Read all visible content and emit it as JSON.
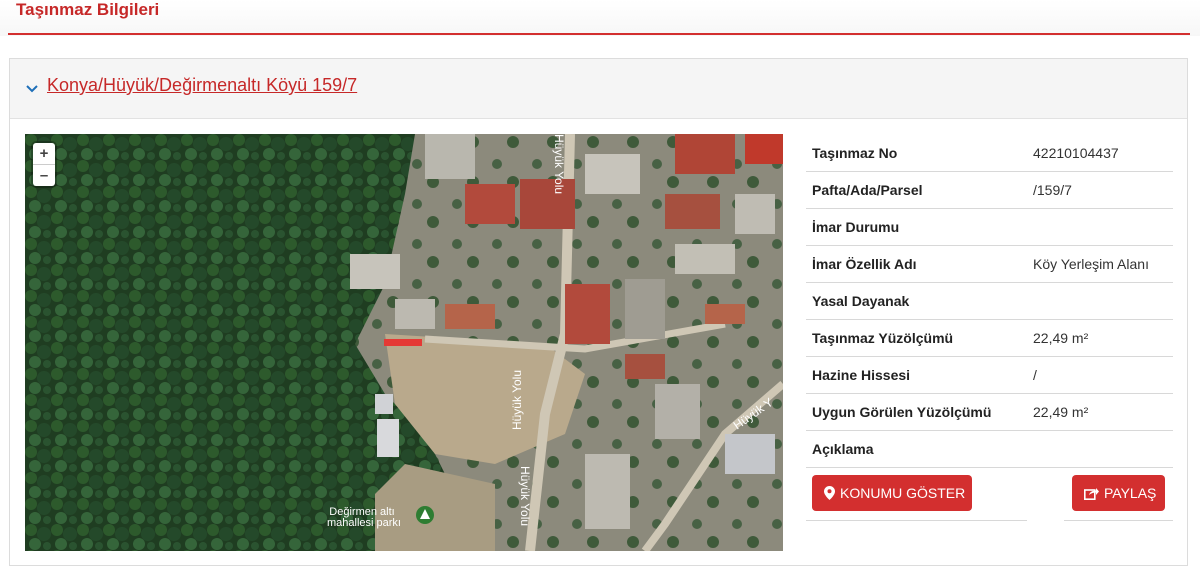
{
  "page": {
    "title": "Taşınmaz Bilgileri"
  },
  "panel": {
    "title": "Konya/Hüyük/Değirmenaltı Köyü 159/7"
  },
  "map": {
    "zoom_in": "+",
    "zoom_out": "–",
    "road_label_1": "Hüyük Yolu",
    "road_label_2": "Hüyük Yolu",
    "road_label_3": "Hüyük Yolu",
    "road_label_4": "Hüyük Y",
    "park_label_1": "Değirmen altı",
    "park_label_2": "mahallesi parkı"
  },
  "info": {
    "rows": [
      {
        "label": "Taşınmaz No",
        "value": "42210104437"
      },
      {
        "label": "Pafta/Ada/Parsel",
        "value": "/159/7"
      },
      {
        "label": "İmar Durumu",
        "value": ""
      },
      {
        "label": "İmar Özellik Adı",
        "value": "Köy Yerleşim Alanı"
      },
      {
        "label": "Yasal Dayanak",
        "value": ""
      },
      {
        "label": "Taşınmaz Yüzölçümü",
        "value": "22,49 m²"
      },
      {
        "label": "Hazine Hissesi",
        "value": "/"
      },
      {
        "label": "Uygun Görülen Yüzölçümü",
        "value": "22,49 m²"
      },
      {
        "label": "Açıklama",
        "value": ""
      }
    ]
  },
  "buttons": {
    "show_location": "KONUMU GÖSTER",
    "share": "PAYLAŞ"
  },
  "colors": {
    "accent": "#d32f2f",
    "title_red": "#c62828"
  }
}
